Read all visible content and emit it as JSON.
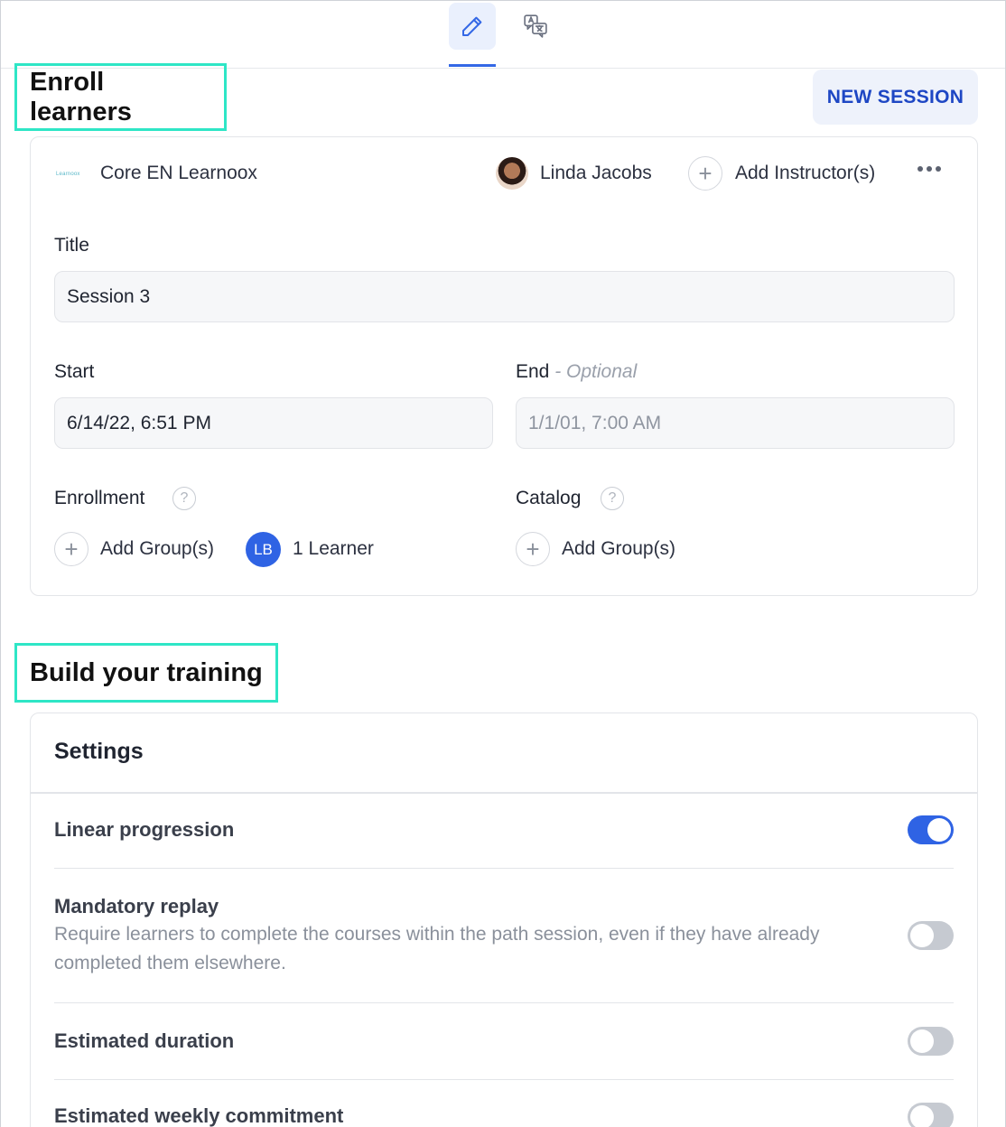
{
  "tabs": [
    {
      "icon": "pencil-icon",
      "active": true
    },
    {
      "icon": "translate-icon",
      "active": false
    }
  ],
  "enroll": {
    "heading": "Enroll learners",
    "new_session_label": "NEW SESSION",
    "course_logo_text": "Learnoox",
    "course_name": "Core EN Learnoox",
    "instructor_name": "Linda Jacobs",
    "add_instructor_label": "Add Instructor(s)",
    "title_label": "Title",
    "title_value": "Session 3",
    "start_label": "Start",
    "start_value": "6/14/22, 6:51 PM",
    "end_label": "End",
    "end_optional": " - Optional",
    "end_value": "1/1/01, 7:00 AM",
    "enrollment_label": "Enrollment",
    "enrollment_add_group": "Add Group(s)",
    "learner_initials": "LB",
    "learner_count": "1 Learner",
    "catalog_label": "Catalog",
    "catalog_add_group": "Add Group(s)",
    "help_glyph": "?",
    "plus_glyph": "+"
  },
  "build": {
    "heading": "Build your training",
    "settings_title": "Settings",
    "settings": [
      {
        "name": "Linear progression",
        "description": "",
        "enabled": true
      },
      {
        "name": "Mandatory replay",
        "description": "Require learners to complete the courses within the path session, even if they have already completed them elsewhere.",
        "enabled": false
      },
      {
        "name": "Estimated duration",
        "description": "",
        "enabled": false
      },
      {
        "name": "Estimated weekly commitment",
        "description": "",
        "enabled": false
      }
    ]
  },
  "colors": {
    "accent": "#2f63e4",
    "highlight_border": "#2ee6c6",
    "button_text": "#1e47c4"
  }
}
